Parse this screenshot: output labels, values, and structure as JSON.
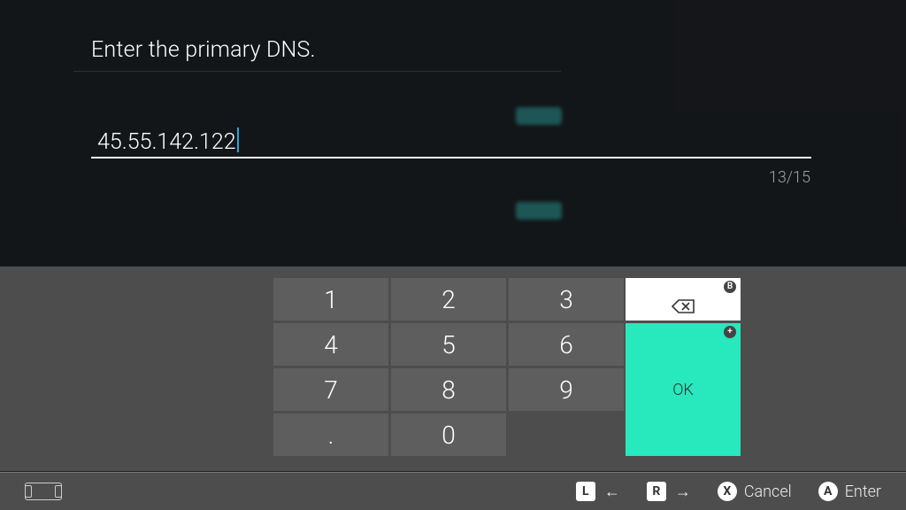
{
  "title": "Enter the primary DNS.",
  "input_value": "45.55.142.122",
  "counter": "13/15",
  "keypad": {
    "keys": [
      "1",
      "2",
      "3",
      "4",
      "5",
      "6",
      "7",
      "8",
      "9",
      ".",
      "0",
      ""
    ],
    "ok": "OK",
    "backspace_badge": "B",
    "ok_badge": "+"
  },
  "footer": {
    "l_label": "L",
    "r_label": "R",
    "l_arrow": "←",
    "r_arrow": "→",
    "x_label": "X",
    "a_label": "A",
    "cancel": "Cancel",
    "enter": "Enter"
  }
}
